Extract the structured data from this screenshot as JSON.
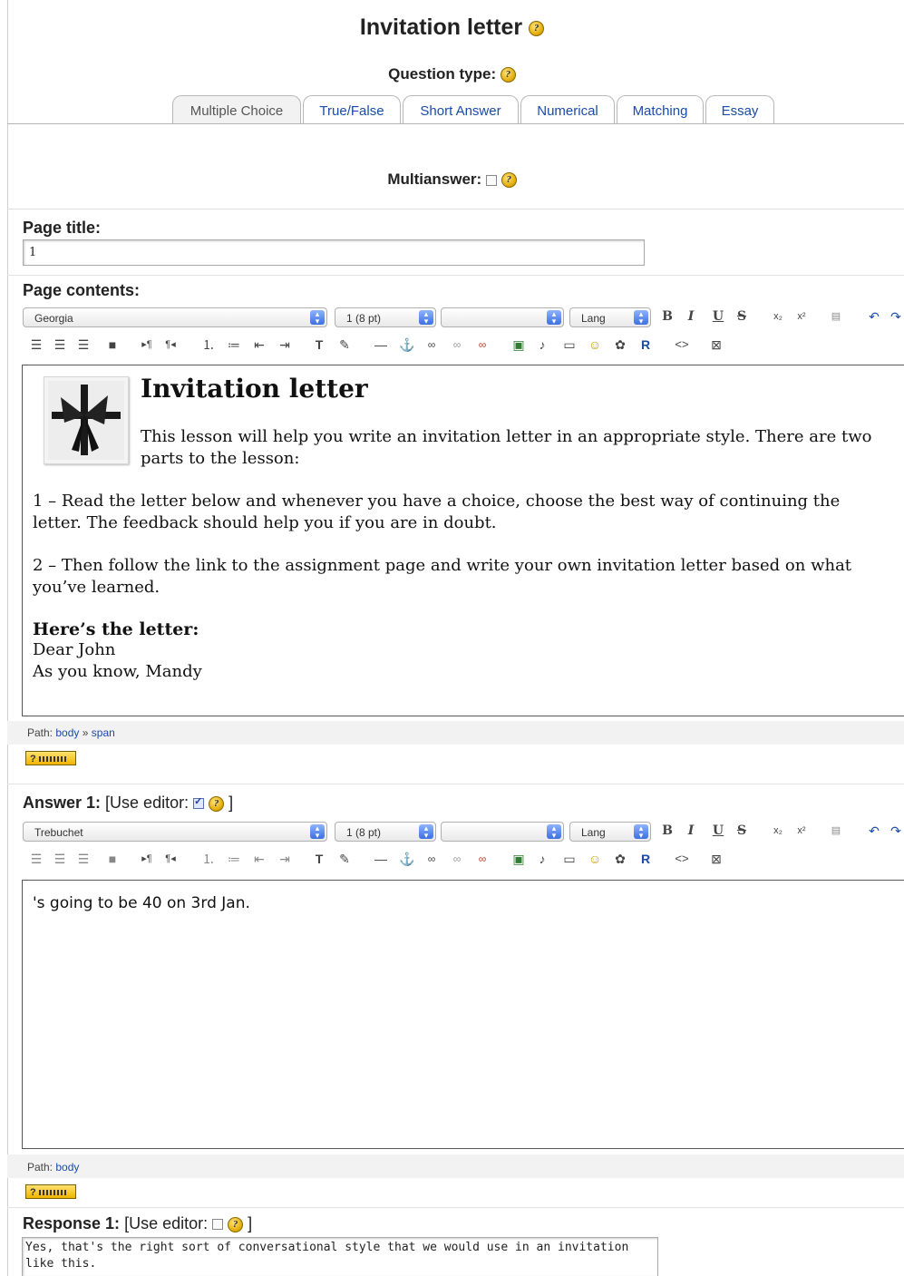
{
  "page": {
    "title": "Invitation letter"
  },
  "question_type": {
    "label": "Question type:",
    "tabs": [
      "Multiple Choice",
      "True/False",
      "Short Answer",
      "Numerical",
      "Matching",
      "Essay"
    ],
    "active": "Multiple Choice"
  },
  "multianswer": {
    "label": "Multianswer:"
  },
  "page_title": {
    "label": "Page title:",
    "value": "1"
  },
  "page_contents": {
    "label": "Page contents:",
    "toolbar": {
      "font": "Georgia",
      "size": "1 (8 pt)",
      "style": "",
      "lang": "Lang"
    },
    "content": {
      "heading": "Invitation letter",
      "intro": "This lesson will help you write an invitation letter in an appropriate style. There are two parts to the lesson:",
      "p1": "1 – Read the letter below and whenever you have a choice, choose the best way of continuing the letter. The feedback should help you if you are in doubt.",
      "p2": "2 – Then follow the link to the assignment page and write your own invitation letter based on what you’ve learned.",
      "letter_heading": "Here’s the letter:",
      "line1": "Dear John",
      "line2": "As you know, Mandy"
    },
    "path_label": "Path:",
    "path_1": "body",
    "path_sep": "»",
    "path_2": "span"
  },
  "answer1": {
    "label": "Answer 1:",
    "use_editor": "[Use editor:",
    "close": "]",
    "toolbar": {
      "font": "Trebuchet",
      "size": "1 (8 pt)",
      "style": "",
      "lang": "Lang"
    },
    "text": "'s going to be 40 on 3rd Jan.",
    "path_label": "Path:",
    "path_1": "body"
  },
  "response1": {
    "label": "Response 1:",
    "use_editor": "[Use editor:",
    "close": "]",
    "text": "Yes, that's the right sort of conversational style that we would use in an invitation like this."
  },
  "help_glyph": "?",
  "icons": [
    "help-icon",
    "checkbox",
    "bold-icon",
    "italic-icon",
    "underline-icon",
    "strikethrough-icon",
    "subscript-icon",
    "superscript-icon",
    "undo-icon",
    "align-left-icon",
    "align-center-icon",
    "align-right-icon",
    "justify-icon",
    "ordered-list-icon",
    "unordered-list-icon",
    "outdent-icon",
    "indent-icon",
    "text-color-icon",
    "background-color-icon",
    "horizontal-rule-icon",
    "anchor-icon",
    "link-icon",
    "unlink-icon",
    "image-icon",
    "emoticon-icon",
    "html-source-icon",
    "keyboard-icon"
  ],
  "colors": {
    "link": "#1a4ba6",
    "section_bg": "#f2f2f2",
    "help_yellow": "#e0a800"
  }
}
